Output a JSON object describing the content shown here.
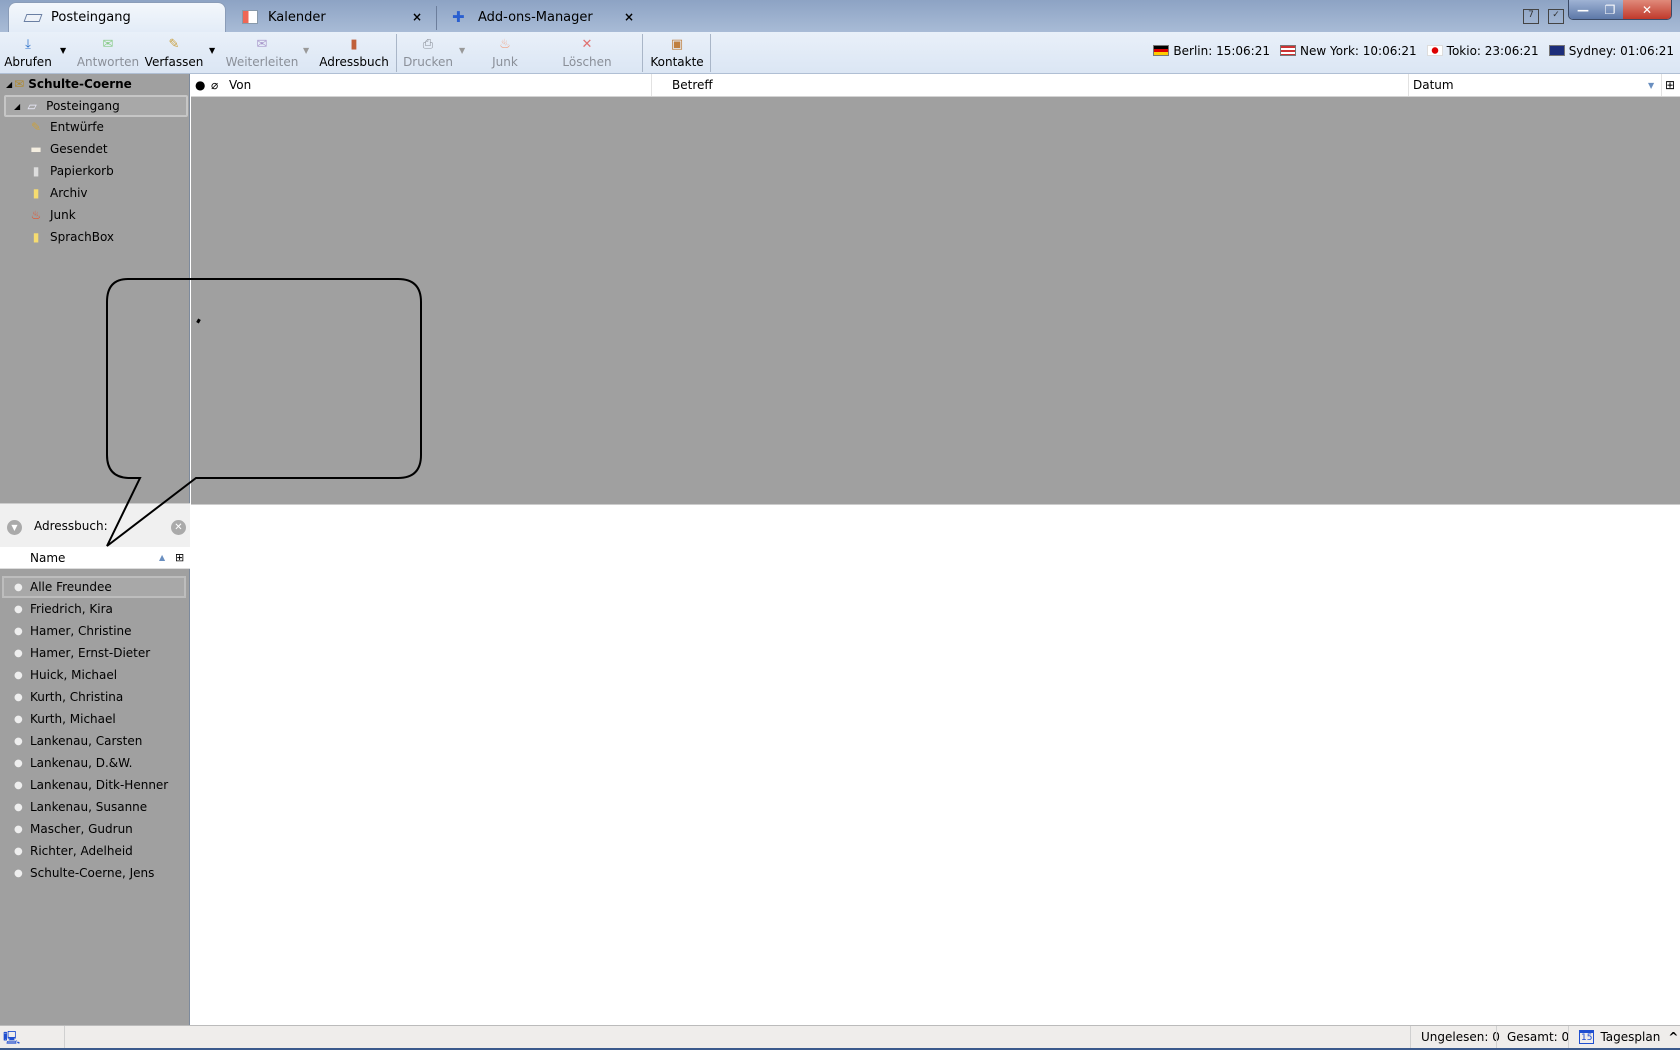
{
  "tabs": [
    {
      "label": "Posteingang",
      "active": true
    },
    {
      "label": "Kalender",
      "close": "×"
    },
    {
      "label": "Add-ons-Manager",
      "close": "×"
    }
  ],
  "window": {
    "minimize": "—",
    "restore": "❐",
    "close": "✕"
  },
  "toolbar": {
    "abrufen": "Abrufen",
    "antworten": "Antworten",
    "verfassen": "Verfassen",
    "weiterleiten": "Weiterleiten",
    "adressbuch": "Adressbuch",
    "drucken": "Drucken",
    "junk": "Junk",
    "loeschen": "Löschen",
    "kontakte": "Kontakte"
  },
  "clocks": [
    {
      "label": "Berlin: 15:06:21"
    },
    {
      "label": "New York: 10:06:21"
    },
    {
      "label": "Tokio: 23:06:21"
    },
    {
      "label": "Sydney: 01:06:21"
    }
  ],
  "account": "Schulte-Coerne",
  "folders": [
    "Posteingang",
    "Entwürfe",
    "Gesendet",
    "Papierkorb",
    "Archiv",
    "Junk",
    "SprachBox"
  ],
  "columns": {
    "von": "Von",
    "betreff": "Betreff",
    "datum": "Datum"
  },
  "addressbook": {
    "label": "Adressbuch:",
    "name_header": "Name",
    "contacts": [
      "Alle Freundee",
      "Friedrich, Kira",
      "Hamer, Christine",
      "Hamer, Ernst-Dieter",
      "Huick, Michael",
      "Kurth, Christina",
      "Kurth, Michael",
      "Lankenau, Carsten",
      "Lankenau, D.&W.",
      "Lankenau, Ditk-Henner",
      "Lankenau, Susanne",
      "Mascher, Gudrun",
      "Richter, Adelheid",
      "Schulte-Coerne, Jens"
    ]
  },
  "status": {
    "unread": "Ungelesen: 0",
    "total": "Gesamt: 0",
    "today": "Tagesplan",
    "today_icon_day": "15"
  }
}
